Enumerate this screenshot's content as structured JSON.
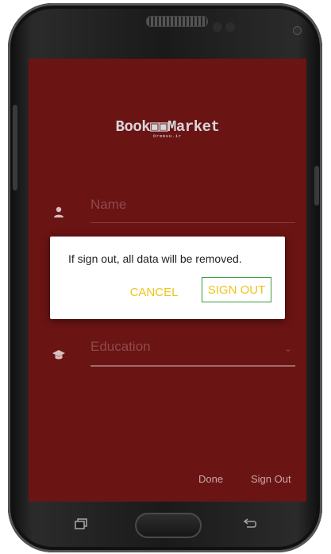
{
  "app": {
    "logo_text": "Book▣▣Market",
    "logo_tagline": "Ormmuu.ir"
  },
  "form": {
    "name_placeholder": "Name",
    "education_placeholder": "Education"
  },
  "dialog": {
    "message": "If sign out, all data will be removed.",
    "cancel_label": "CANCEL",
    "sign_out_label": "SIGN OUT"
  },
  "actions": {
    "done_label": "Done",
    "sign_out_label": "Sign Out"
  },
  "colors": {
    "screen_bg": "#6b1414",
    "accent": "#f0c419",
    "focus_border": "#3a9a3a"
  },
  "icons": {
    "name_field": "person-icon",
    "education_field": "graduation-cap-icon",
    "dropdown": "chevron-down-icon",
    "recents": "recent-apps-icon",
    "back": "back-icon"
  }
}
